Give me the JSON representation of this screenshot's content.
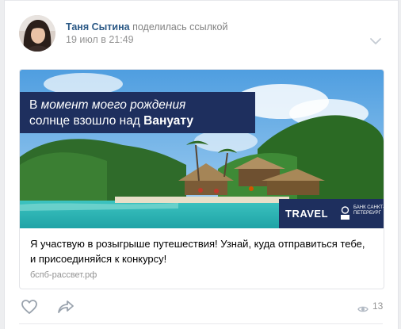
{
  "post": {
    "author_name": "Таня Сытина",
    "action_text": " поделилась ссылкой",
    "date": "19 июл в 21:49",
    "menu_icon": "chevron-down-icon"
  },
  "card": {
    "banner": {
      "headline_line1_normal": "В ",
      "headline_line1_italic": "момент моего рождения",
      "headline_line2_normal": "солнце взошло над ",
      "headline_line2_bold": "Вануату",
      "travel_label": "TRAVEL",
      "bank_logo_text": "БАНК САНКТ-ПЕТЕРБУРГ"
    },
    "title": "Я участвую в розыгрыше путешествия! Узнай, куда отправиться тебе, и присоединяйся к конкурсу!",
    "domain": "бспб-рассвет.рф"
  },
  "actions": {
    "like_icon": "heart-icon",
    "share_icon": "share-arrow-icon",
    "views_icon": "eye-icon",
    "views_count": "13"
  },
  "colors": {
    "link": "#2a5885",
    "muted": "#939393",
    "banner_navy": "#1e2f5e"
  }
}
